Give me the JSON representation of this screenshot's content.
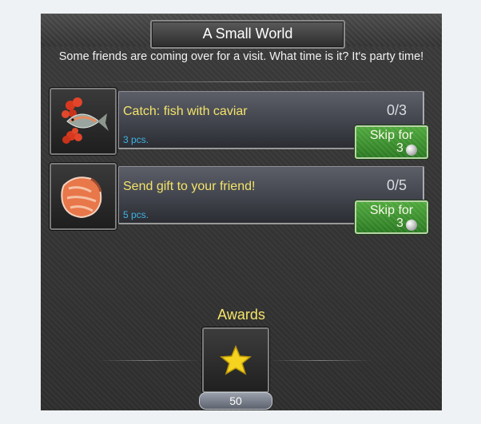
{
  "quest": {
    "title": "A Small World",
    "description": "Some friends are coming over for a visit. What time is it? It's party time!"
  },
  "tasks": [
    {
      "title": "Catch: fish with caviar",
      "progress": "0/3",
      "quantity": "3 pcs.",
      "skip_label": "Skip for",
      "skip_cost": "3",
      "icon": "fish-with-caviar-icon"
    },
    {
      "title": "Send gift to your friend!",
      "progress": "0/5",
      "quantity": "5 pcs.",
      "skip_label": "Skip for",
      "skip_cost": "3",
      "icon": "salmon-fillet-icon"
    }
  ],
  "awards": {
    "label": "Awards",
    "value": "50",
    "icon": "star-icon"
  },
  "colors": {
    "title_text": "#ffffff",
    "task_text": "#f4e36a",
    "quantity_text": "#3fb3e6",
    "skip_button": "#2b7a22",
    "awards_text": "#f4e36a"
  }
}
